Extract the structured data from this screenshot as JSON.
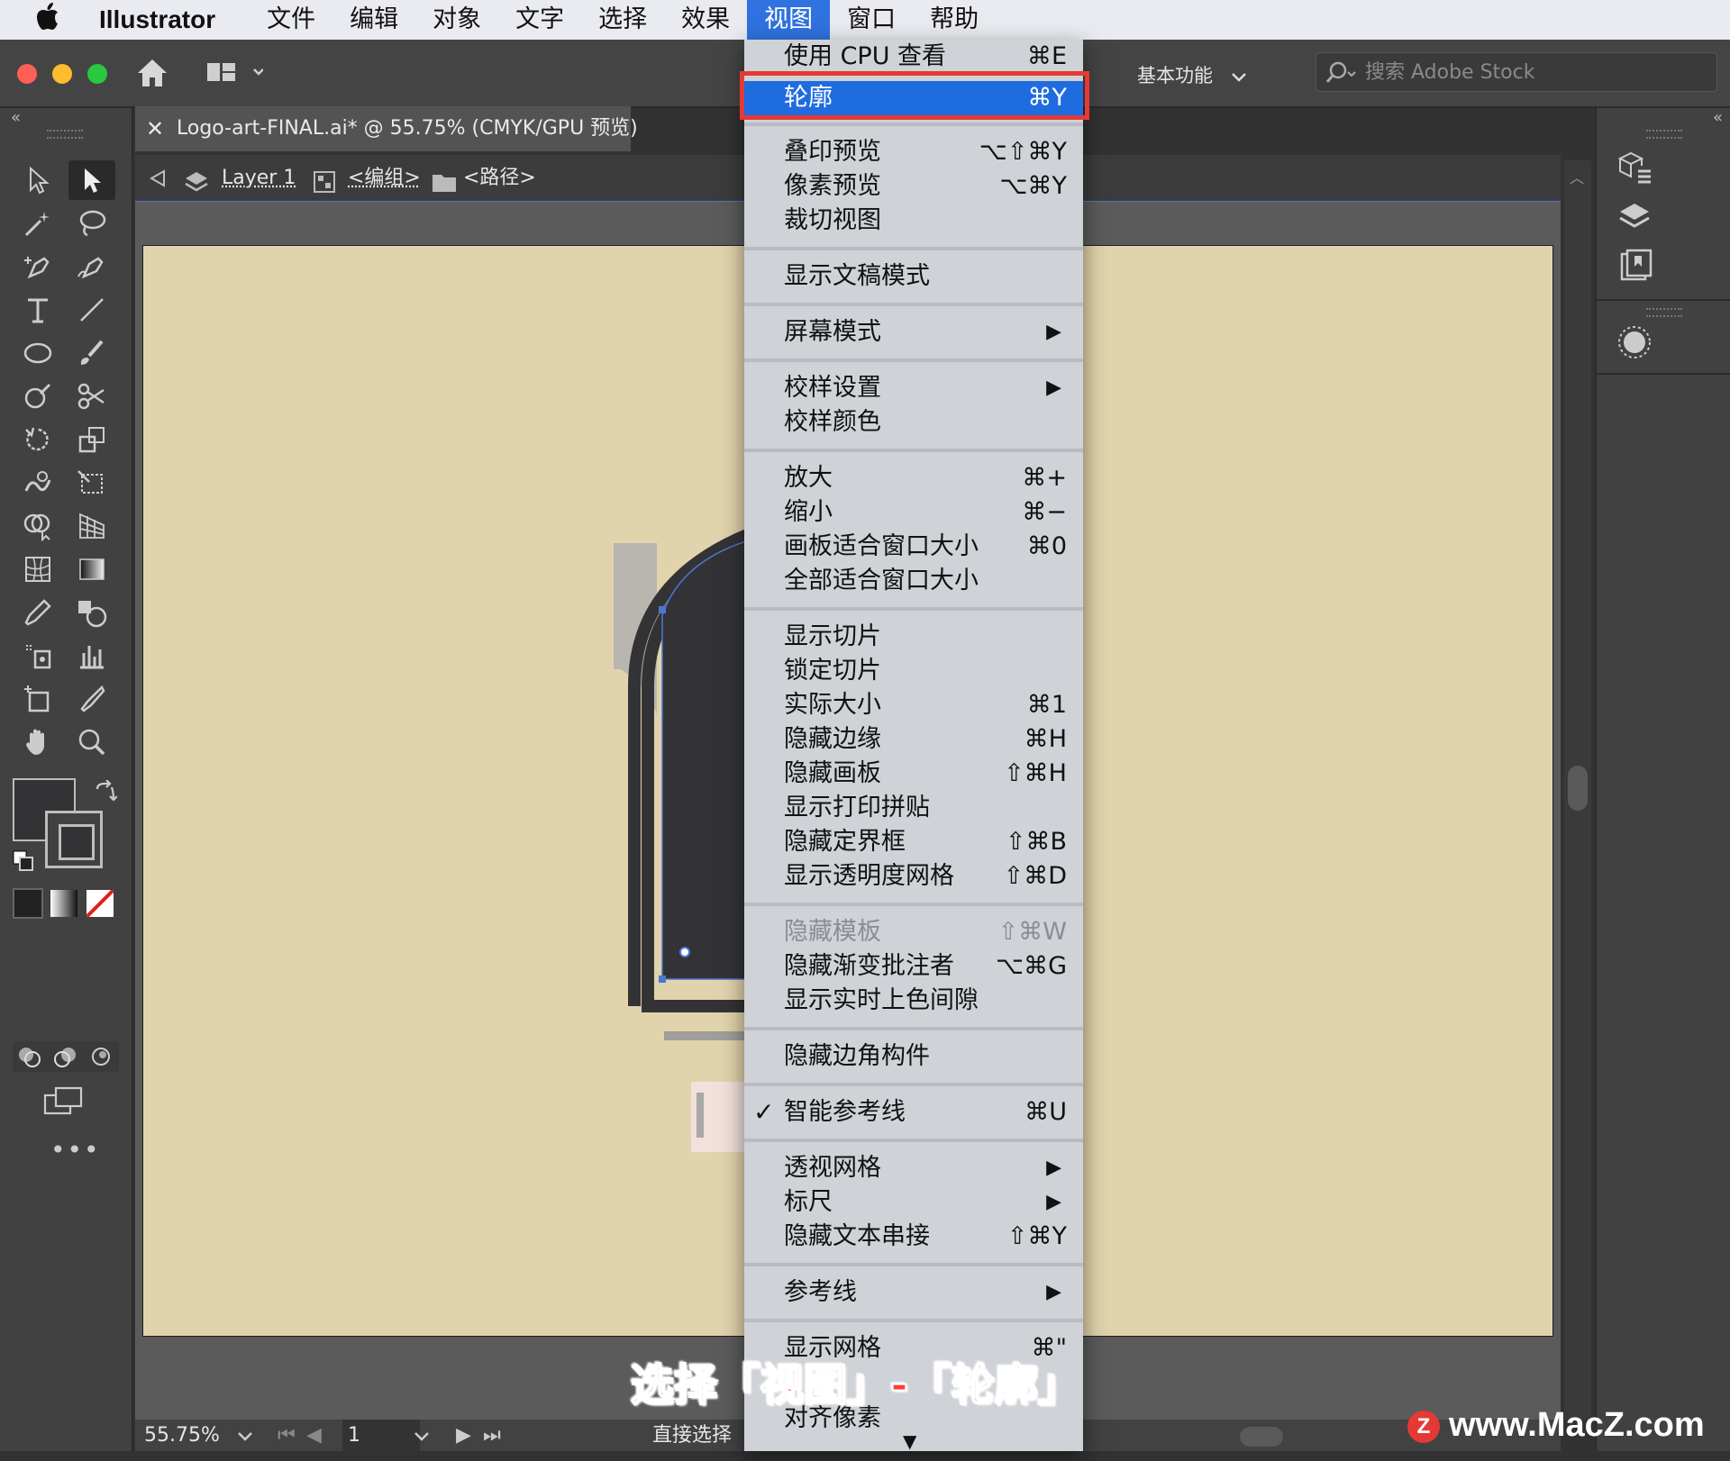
{
  "menubar": {
    "app_name": "Illustrator",
    "menus": [
      "文件",
      "编辑",
      "对象",
      "文字",
      "选择",
      "效果",
      "视图",
      "窗口",
      "帮助"
    ],
    "active_menu": "视图"
  },
  "toolbar": {
    "workspace": "基本功能",
    "stock_search_placeholder": "搜索 Adobe Stock"
  },
  "document": {
    "tab_title": "Logo-art-FINAL.ai* @ 55.75% (CMYK/GPU 预览)",
    "breadcrumb": {
      "layer": "Layer 1",
      "group": "<编组>",
      "path": "<路径>"
    },
    "artboard_color": "#e1d3ac"
  },
  "status": {
    "zoom": "55.75%",
    "artboard_number": "1",
    "tool_name": "直接选择"
  },
  "view_menu": {
    "items": [
      {
        "label": "使用 CPU 查看",
        "shortcut": "⌘E"
      },
      {
        "label": "轮廓",
        "shortcut": "⌘Y",
        "highlighted": true
      },
      {
        "label": "叠印预览",
        "shortcut": "⌥⇧⌘Y"
      },
      {
        "label": "像素预览",
        "shortcut": "⌥⌘Y"
      },
      {
        "label": "裁切视图",
        "shortcut": ""
      },
      {
        "label": "显示文稿模式",
        "shortcut": ""
      },
      {
        "label": "屏幕模式",
        "submenu": true
      },
      {
        "label": "校样设置",
        "submenu": true
      },
      {
        "label": "校样颜色",
        "shortcut": ""
      },
      {
        "label": "放大",
        "shortcut": "⌘+"
      },
      {
        "label": "缩小",
        "shortcut": "⌘−"
      },
      {
        "label": "画板适合窗口大小",
        "shortcut": "⌘0"
      },
      {
        "label": "全部适合窗口大小",
        "shortcut": ""
      },
      {
        "label": "显示切片",
        "shortcut": ""
      },
      {
        "label": "锁定切片",
        "shortcut": ""
      },
      {
        "label": "实际大小",
        "shortcut": "⌘1"
      },
      {
        "label": "隐藏边缘",
        "shortcut": "⌘H"
      },
      {
        "label": "隐藏画板",
        "shortcut": "⇧⌘H"
      },
      {
        "label": "显示打印拼贴",
        "shortcut": ""
      },
      {
        "label": "隐藏定界框",
        "shortcut": "⇧⌘B"
      },
      {
        "label": "显示透明度网格",
        "shortcut": "⇧⌘D"
      },
      {
        "label": "隐藏模板",
        "shortcut": "⇧⌘W",
        "disabled": true
      },
      {
        "label": "隐藏渐变批注者",
        "shortcut": "⌥⌘G"
      },
      {
        "label": "显示实时上色间隙",
        "shortcut": ""
      },
      {
        "label": "隐藏边角构件",
        "shortcut": ""
      },
      {
        "label": "智能参考线",
        "shortcut": "⌘U",
        "checked": true
      },
      {
        "label": "透视网格",
        "submenu": true
      },
      {
        "label": "标尺",
        "submenu": true
      },
      {
        "label": "隐藏文本串接",
        "shortcut": "⇧⌘Y"
      },
      {
        "label": "参考线",
        "submenu": true
      },
      {
        "label": "显示网格",
        "shortcut": "⌘\""
      },
      {
        "label": "对齐像素",
        "shortcut": ""
      }
    ]
  },
  "caption": "选择「视图」-「轮廓」",
  "watermark": "www.MacZ.com"
}
